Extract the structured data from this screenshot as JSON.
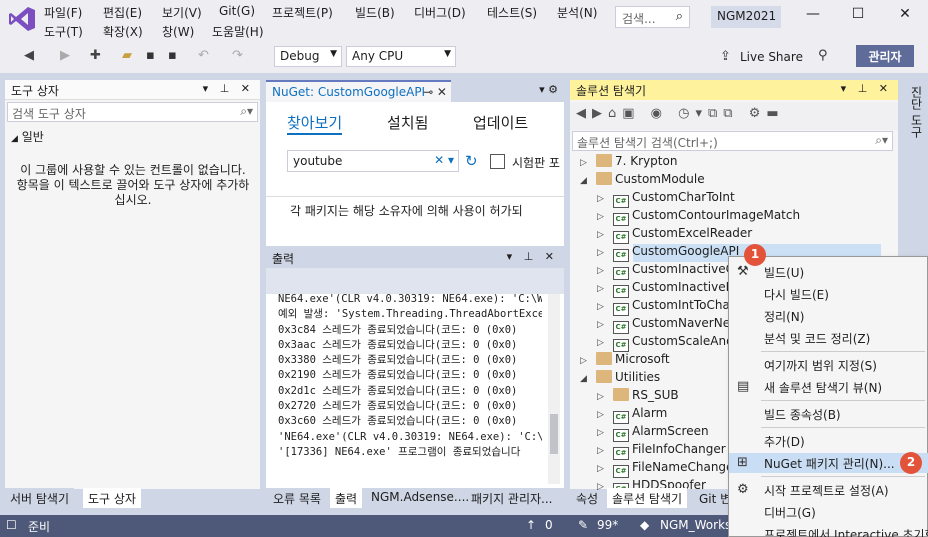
{
  "menubar": {
    "items": [
      "파일(F)",
      "편집(E)",
      "보기(V)",
      "Git(G)",
      "프로젝트(P)",
      "빌드(B)",
      "디버그(D)",
      "테스트(S)",
      "분석(N)",
      "도구(T)",
      "확장(X)",
      "창(W)",
      "도움말(H)"
    ],
    "search_placeholder": "검색...",
    "solution_name": "NGM2021"
  },
  "toolbar": {
    "config": "Debug",
    "platform": "Any CPU",
    "live_share": "Live Share",
    "admin": "관리자"
  },
  "toolbox": {
    "title": "도구 상자",
    "search_placeholder": "검색 도구 상자",
    "group": "일반",
    "empty_message": "이 그룹에 사용할 수 있는 컨트롤이 없습니다. 항목을 이 텍스트로 끌어와 도구 상자에 추가하십시오."
  },
  "nuget": {
    "tab_title": "NuGet: CustomGoogleAPI",
    "tabs": [
      "찾아보기",
      "설치됨",
      "업데이트"
    ],
    "search_value": "youtube",
    "prerelease_label": "시험판 포",
    "info_text": "각 패키지는 해당 소유자에 의해 사용이 허가되"
  },
  "output": {
    "title": "출력",
    "lines": [
      "NE64.exe'(CLR v4.0.30319: NE64.exe): 'C:\\Wi",
      "예외 발생: 'System.Threading.ThreadAbortExce",
      "0x3c84 스레드가 종료되었습니다(코드: 0 (0x0)",
      "0x3aac 스레드가 종료되었습니다(코드: 0 (0x0)",
      "0x3380 스레드가 종료되었습니다(코드: 0 (0x0)",
      "0x2190 스레드가 종료되었습니다(코드: 0 (0x0)",
      "0x2d1c 스레드가 종료되었습니다(코드: 0 (0x0)",
      "0x2720 스레드가 종료되었습니다(코드: 0 (0x0)",
      "0x3c60 스레드가 종료되었습니다(코드: 0 (0x0)",
      "'NE64.exe'(CLR v4.0.30319: NE64.exe): 'C:\\Wi",
      "'[17336] NE64.exe' 프로그램이 종료되었습니다"
    ]
  },
  "solution_explorer": {
    "title": "솔루션 탐색기",
    "search_placeholder": "솔루션 탐색기 검색(Ctrl+;)",
    "side_label": "진단 도구",
    "nodes": [
      {
        "label": "7. Krypton",
        "kind": "folder",
        "level": 1,
        "expander": "▷"
      },
      {
        "label": "CustomModule",
        "kind": "folder",
        "level": 1,
        "expander": "◢"
      },
      {
        "label": "CustomCharToInt",
        "kind": "proj",
        "level": 2,
        "expander": "▷"
      },
      {
        "label": "CustomContourImageMatch",
        "kind": "proj",
        "level": 2,
        "expander": "▷"
      },
      {
        "label": "CustomExcelReader",
        "kind": "proj",
        "level": 2,
        "expander": "▷"
      },
      {
        "label": "CustomGoogleAPI",
        "kind": "proj",
        "level": 2,
        "expander": "▷"
      },
      {
        "label": "CustomInactiveC",
        "kind": "proj",
        "level": 2,
        "expander": "▷"
      },
      {
        "label": "CustomInactiveK",
        "kind": "proj",
        "level": 2,
        "expander": "▷"
      },
      {
        "label": "CustomIntToCha",
        "kind": "proj",
        "level": 2,
        "expander": "▷"
      },
      {
        "label": "CustomNaverNe",
        "kind": "proj",
        "level": 2,
        "expander": "▷"
      },
      {
        "label": "CustomScaleAnd",
        "kind": "proj",
        "level": 2,
        "expander": "▷"
      },
      {
        "label": "Microsoft",
        "kind": "folder",
        "level": 1,
        "expander": "▷"
      },
      {
        "label": "Utilities",
        "kind": "folder",
        "level": 1,
        "expander": "◢"
      },
      {
        "label": "RS_SUB",
        "kind": "folder",
        "level": 2,
        "expander": "▷"
      },
      {
        "label": "Alarm",
        "kind": "proj",
        "level": 2,
        "expander": "▷"
      },
      {
        "label": "AlarmScreen",
        "kind": "proj",
        "level": 2,
        "expander": "▷"
      },
      {
        "label": "FileInfoChanger",
        "kind": "proj",
        "level": 2,
        "expander": "▷"
      },
      {
        "label": "FileNameChange",
        "kind": "proj",
        "level": 2,
        "expander": "▷"
      },
      {
        "label": "HDDSpoofer",
        "kind": "proj",
        "level": 2,
        "expander": "▷"
      }
    ]
  },
  "context_menu": {
    "items": [
      "빌드(U)",
      "다시 빌드(E)",
      "정리(N)",
      "분석 및 코드 정리(Z)",
      "여기까지 범위 지정(S)",
      "새 솔루션 탐색기 뷰(N)",
      "빌드 종속성(B)",
      "추가(D)",
      "NuGet 패키지 관리(N)...",
      "시작 프로젝트로 설정(A)",
      "디버그(G)",
      "프로젝트에서 Interactive 초기화"
    ]
  },
  "badges": [
    "1",
    "2"
  ],
  "bottom_tabs": {
    "left": [
      "서버 탐색기",
      "도구 상자"
    ],
    "middle": [
      "오류 목록",
      "출력",
      "NGM.Adsense....",
      "패키지 관리자..."
    ],
    "right": [
      "속성",
      "솔루션 탐색기",
      "Git 변"
    ]
  },
  "status": {
    "ready": "준비",
    "up_count": "0",
    "changes": "99*",
    "repo": "NGM_Works"
  },
  "colors": {
    "accent": "#6579be",
    "solution_header": "#fff29d",
    "badge": "#e2533a",
    "status_bar": "#4e5878",
    "selection": "#cce0f5"
  }
}
